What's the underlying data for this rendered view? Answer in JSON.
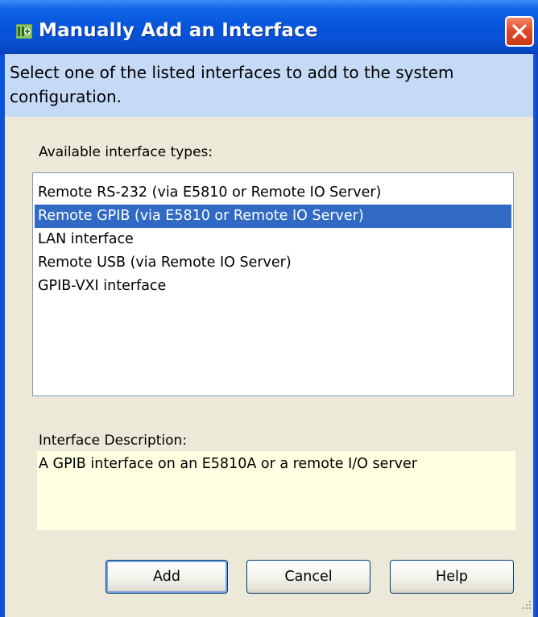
{
  "window": {
    "title": "Manually Add an Interface",
    "app_icon": "config-app-icon",
    "close_icon": "close-icon"
  },
  "instructions": "Select one of the listed interfaces to add to the system configuration.",
  "available": {
    "label": "Available interface types:",
    "items": [
      {
        "label": "Remote RS-232 (via E5810 or Remote IO Server)",
        "selected": false
      },
      {
        "label": "Remote GPIB (via E5810 or Remote IO Server)",
        "selected": true
      },
      {
        "label": "LAN interface",
        "selected": false
      },
      {
        "label": "Remote USB (via Remote IO Server)",
        "selected": false
      },
      {
        "label": "GPIB-VXI interface",
        "selected": false
      }
    ]
  },
  "description": {
    "label": "Interface Description:",
    "text": "A GPIB interface on an E5810A or a remote I/O server"
  },
  "buttons": {
    "add": "Add",
    "cancel": "Cancel",
    "help": "Help"
  },
  "colors": {
    "titlebar": "#0553db",
    "selection": "#316ac5",
    "instructions_bg": "#c4daf6",
    "description_bg": "#ffffe1",
    "close_button": "#e04b28"
  }
}
